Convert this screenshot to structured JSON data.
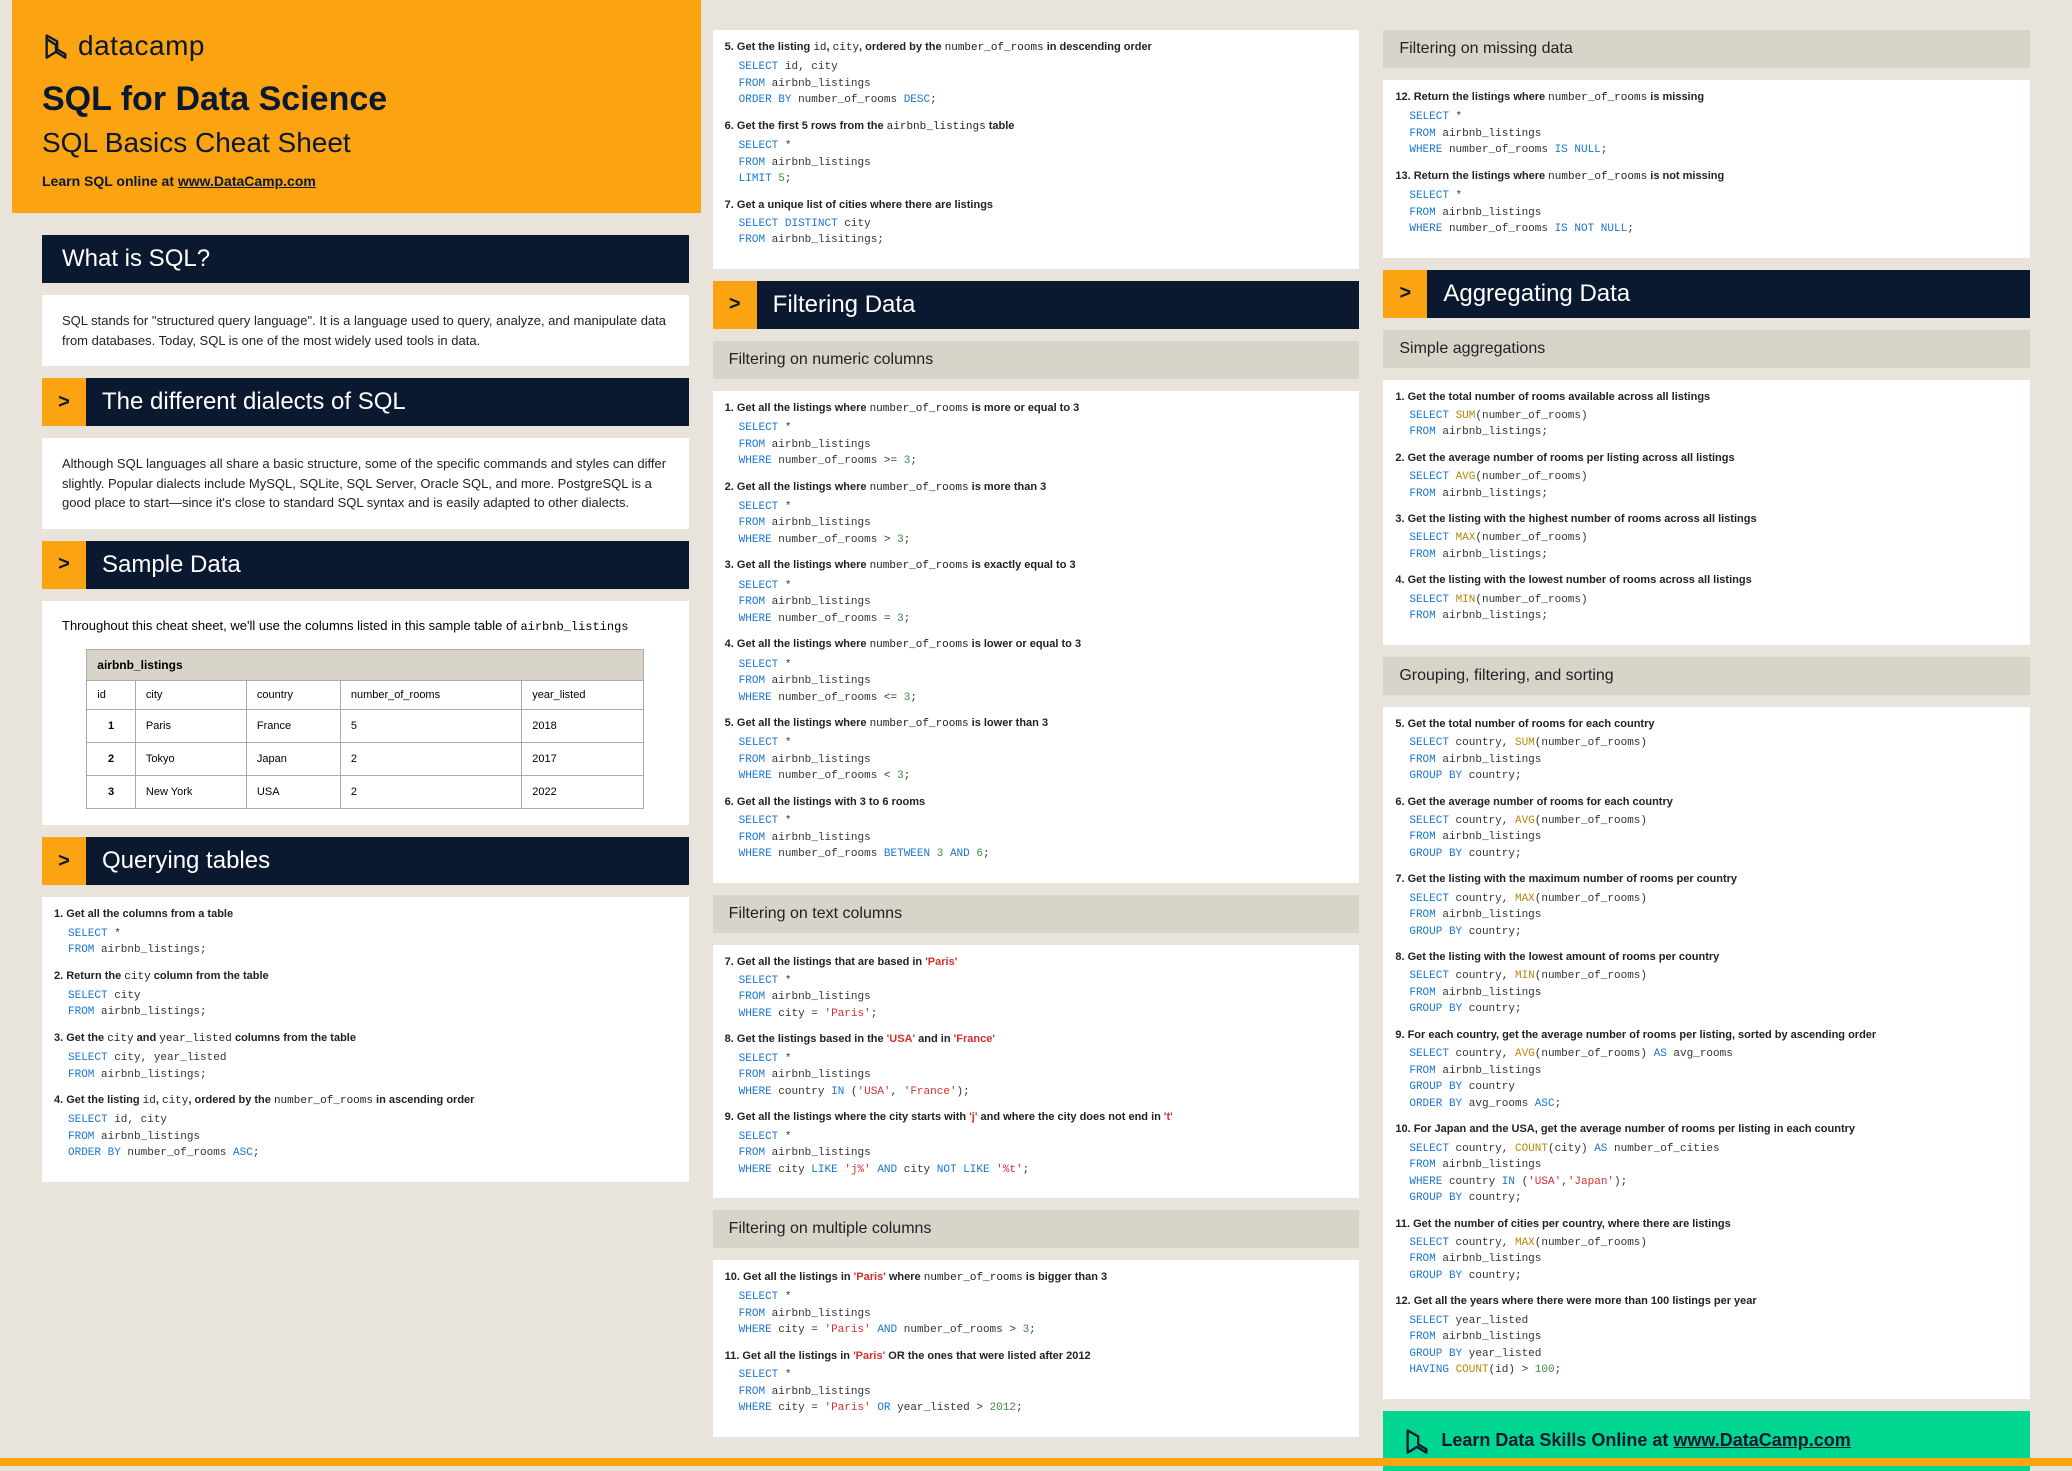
{
  "brand": {
    "name": "datacamp"
  },
  "header": {
    "title": "SQL for Data Science",
    "subtitle": "SQL Basics Cheat Sheet",
    "learn_prefix": "Learn SQL online at ",
    "learn_link": "www.DataCamp.com"
  },
  "what_is_sql": {
    "title": "What is SQL?",
    "body": "SQL stands for \"structured query language\". It is a language used to query, analyze, and manipulate data from databases. Today, SQL is one of the most widely used tools in data."
  },
  "dialects": {
    "title": "The different dialects of SQL",
    "body": "Although SQL languages all share a basic structure, some of the specific commands and styles can differ slightly. Popular dialects include MySQL, SQLite, SQL Server, Oracle SQL, and more. PostgreSQL is a good place to start—since it's close to standard SQL syntax and is easily adapted to other dialects."
  },
  "sample": {
    "title": "Sample Data",
    "intro_a": "Throughout this cheat sheet, we'll use the columns listed in this sample table of ",
    "intro_b": "airbnb_listings",
    "table_name": "airbnb_listings",
    "cols": [
      "id",
      "city",
      "country",
      "number_of_rooms",
      "year_listed"
    ],
    "rows": [
      [
        "1",
        "Paris",
        "France",
        "5",
        "2018"
      ],
      [
        "2",
        "Tokyo",
        "Japan",
        "2",
        "2017"
      ],
      [
        "3",
        "New York",
        "USA",
        "2",
        "2022"
      ]
    ]
  },
  "querying": {
    "title": "Querying tables",
    "items": [
      {
        "n": "1.",
        "label": "Get all the columns from a table",
        "code": "<span class='kw'>SELECT</span> *\n<span class='kw'>FROM</span> airbnb_listings;"
      },
      {
        "n": "2.",
        "label_html": "Return the <span class='mono'>city</span> column from the table",
        "code": "<span class='kw'>SELECT</span> city\n<span class='kw'>FROM</span> airbnb_listings;"
      },
      {
        "n": "3.",
        "label_html": "Get the <span class='mono'>city</span> and <span class='mono'>year_listed</span> columns from the table",
        "code": "<span class='kw'>SELECT</span> city, year_listed\n<span class='kw'>FROM</span> airbnb_listings;"
      },
      {
        "n": "4.",
        "label_html": "Get the listing <span class='mono'>id</span>, <span class='mono'>city</span>, ordered by the <span class='mono'>number_of_rooms</span> in ascending order",
        "code": "<span class='kw'>SELECT</span> id, city\n<span class='kw'>FROM</span> airbnb_listings\n<span class='kw'>ORDER BY</span> number_of_rooms <span class='kw'>ASC</span>;"
      }
    ]
  },
  "querying2": {
    "items": [
      {
        "n": "5.",
        "label_html": "Get the listing <span class='mono'>id</span>, <span class='mono'>city</span>, ordered by the <span class='mono'>number_of_rooms</span> in descending order",
        "code": "<span class='kw'>SELECT</span> id, city\n<span class='kw'>FROM</span> airbnb_listings\n<span class='kw'>ORDER BY</span> number_of_rooms <span class='kw'>DESC</span>;"
      },
      {
        "n": "6.",
        "label_html": "Get the first 5 rows from the <span class='mono'>airbnb_listings</span> table",
        "code": "<span class='kw'>SELECT</span> *\n<span class='kw'>FROM</span> airbnb_listings\n<span class='kw'>LIMIT</span> <span class='num'>5</span>;"
      },
      {
        "n": "7.",
        "label": "Get a unique list of cities where there are listings",
        "code": "<span class='kw'>SELECT DISTINCT</span> city\n<span class='kw'>FROM</span> airbnb_lisitings;"
      }
    ]
  },
  "filtering": {
    "title": "Filtering Data",
    "sub_numeric": "Filtering on numeric columns",
    "numeric": [
      {
        "n": "1.",
        "label_html": "Get all the listings where <span class='mono'>number_of_rooms</span> is more or equal to 3",
        "code": "<span class='kw'>SELECT</span> *\n<span class='kw'>FROM</span> airbnb_listings\n<span class='kw'>WHERE</span> number_of_rooms >= <span class='num'>3</span>;"
      },
      {
        "n": "2.",
        "label_html": "Get all the listings where <span class='mono'>number_of_rooms</span> is more than 3",
        "code": "<span class='kw'>SELECT</span> *\n<span class='kw'>FROM</span> airbnb_listings\n<span class='kw'>WHERE</span> number_of_rooms > <span class='num'>3</span>;"
      },
      {
        "n": "3.",
        "label_html": "Get all the listings where <span class='mono'>number_of_rooms</span> is exactly equal to 3",
        "code": "<span class='kw'>SELECT</span> *\n<span class='kw'>FROM</span> airbnb_listings\n<span class='kw'>WHERE</span> number_of_rooms = <span class='num'>3</span>;"
      },
      {
        "n": "4.",
        "label_html": "Get all the listings where <span class='mono'>number_of_rooms</span> is lower or equal to 3",
        "code": "<span class='kw'>SELECT</span> *\n<span class='kw'>FROM</span> airbnb_listings\n<span class='kw'>WHERE</span> number_of_rooms <= <span class='num'>3</span>;"
      },
      {
        "n": "5.",
        "label_html": "Get all the listings where <span class='mono'>number_of_rooms</span> is lower than 3",
        "code": "<span class='kw'>SELECT</span> *\n<span class='kw'>FROM</span> airbnb_listings\n<span class='kw'>WHERE</span> number_of_rooms < <span class='num'>3</span>;"
      },
      {
        "n": "6.",
        "label": "Get all the listings with 3 to 6 rooms",
        "code": "<span class='kw'>SELECT</span> *\n<span class='kw'>FROM</span> airbnb_listings\n<span class='kw'>WHERE</span> number_of_rooms <span class='kw'>BETWEEN</span> <span class='num'>3</span> <span class='kw'>AND</span> <span class='num'>6</span>;"
      }
    ],
    "sub_text": "Filtering on text columns",
    "text": [
      {
        "n": "7.",
        "label_html": "Get all the listings that are based in <span class='str'>'Paris'</span>",
        "code": "<span class='kw'>SELECT</span> *\n<span class='kw'>FROM</span> airbnb_listings\n<span class='kw'>WHERE</span> city = <span class='str'>'Paris'</span>;"
      },
      {
        "n": "8.",
        "label_html": "Get the listings based in the <span class='str'>'USA'</span> and in <span class='str'>'France'</span>",
        "code": "<span class='kw'>SELECT</span> *\n<span class='kw'>FROM</span> airbnb_listings\n<span class='kw'>WHERE</span> country <span class='kw'>IN</span> (<span class='str'>'USA'</span>, <span class='str'>'France'</span>);"
      },
      {
        "n": "9.",
        "label_html": "Get all the listings where the city starts with <span class='str'>'j'</span> and where the city does not end in <span class='str'>'t'</span>",
        "code": "<span class='kw'>SELECT</span> *\n<span class='kw'>FROM</span> airbnb_listings\n<span class='kw'>WHERE</span> city <span class='kw'>LIKE</span> <span class='str'>'j%'</span> <span class='kw'>AND</span> city <span class='kw'>NOT LIKE</span> <span class='str'>'%t'</span>;"
      }
    ],
    "sub_multi": "Filtering on multiple columns",
    "multi": [
      {
        "n": "10.",
        "label_html": "Get all the listings in <span class='str'>'Paris'</span> where <span class='mono'>number_of_rooms</span> is bigger than 3",
        "code": "<span class='kw'>SELECT</span> *\n<span class='kw'>FROM</span> airbnb_listings\n<span class='kw'>WHERE</span> city = <span class='str'>'Paris'</span> <span class='kw'>AND</span> number_of_rooms > <span class='num'>3</span>;"
      },
      {
        "n": "11.",
        "label_html": "Get all the listings in <span class='str'>'Paris'</span> OR the ones that were listed after 2012",
        "code": "<span class='kw'>SELECT</span> *\n<span class='kw'>FROM</span> airbnb_listings\n<span class='kw'>WHERE</span> city = <span class='str'>'Paris'</span> <span class='kw'>OR</span> year_listed > <span class='num'>2012</span>;"
      }
    ],
    "sub_missing": "Filtering on missing data",
    "missing": [
      {
        "n": "12.",
        "label_html": "Return the listings where <span class='mono'>number_of_rooms</span> is missing",
        "code": "<span class='kw'>SELECT</span> *\n<span class='kw'>FROM</span> airbnb_listings\n<span class='kw'>WHERE</span> number_of_rooms <span class='kw'>IS NULL</span>;"
      },
      {
        "n": "13.",
        "label_html": "Return the listings where <span class='mono'>number_of_rooms</span> is not missing",
        "code": "<span class='kw'>SELECT</span> *\n<span class='kw'>FROM</span> airbnb_listings\n<span class='kw'>WHERE</span> number_of_rooms <span class='kw'>IS NOT NULL</span>;"
      }
    ]
  },
  "agg": {
    "title": "Aggregating Data",
    "sub_simple": "Simple aggregations",
    "simple": [
      {
        "n": "1.",
        "label": "Get the total number of rooms available across all listings",
        "code": "<span class='kw'>SELECT</span> <span class='fn'>SUM</span>(number_of_rooms)\n<span class='kw'>FROM</span> airbnb_listings;"
      },
      {
        "n": "2.",
        "label": "Get the average number of rooms per listing across all listings",
        "code": "<span class='kw'>SELECT</span> <span class='fn'>AVG</span>(number_of_rooms)\n<span class='kw'>FROM</span> airbnb_listings;"
      },
      {
        "n": "3.",
        "label": "Get the listing with the highest number of rooms across all listings",
        "code": "<span class='kw'>SELECT</span> <span class='fn'>MAX</span>(number_of_rooms)\n<span class='kw'>FROM</span> airbnb_listings;"
      },
      {
        "n": "4.",
        "label": "Get the listing with the lowest number of rooms across all listings",
        "code": "<span class='kw'>SELECT</span> <span class='fn'>MIN</span>(number_of_rooms)\n<span class='kw'>FROM</span> airbnb_listings;"
      }
    ],
    "sub_group": "Grouping, filtering, and sorting",
    "group": [
      {
        "n": "5.",
        "label": "Get the total number of rooms for each country",
        "code": "<span class='kw'>SELECT</span> country, <span class='fn'>SUM</span>(number_of_rooms)\n<span class='kw'>FROM</span> airbnb_listings\n<span class='kw'>GROUP BY</span> country;"
      },
      {
        "n": "6.",
        "label": "Get the average number of rooms for each country",
        "code": "<span class='kw'>SELECT</span> country, <span class='fn'>AVG</span>(number_of_rooms)\n<span class='kw'>FROM</span> airbnb_listings\n<span class='kw'>GROUP BY</span> country;"
      },
      {
        "n": "7.",
        "label": "Get the listing with the maximum number of rooms per country",
        "code": "<span class='kw'>SELECT</span> country, <span class='fn'>MAX</span>(number_of_rooms)\n<span class='kw'>FROM</span> airbnb_listings\n<span class='kw'>GROUP BY</span> country;"
      },
      {
        "n": "8.",
        "label": "Get the listing with the lowest amount of rooms per country",
        "code": "<span class='kw'>SELECT</span> country, <span class='fn'>MIN</span>(number_of_rooms)\n<span class='kw'>FROM</span> airbnb_listings\n<span class='kw'>GROUP BY</span> country;"
      },
      {
        "n": "9.",
        "label": "For each country, get the average number of rooms per listing, sorted by ascending order",
        "code": "<span class='kw'>SELECT</span> country, <span class='fn'>AVG</span>(number_of_rooms) <span class='kw'>AS</span> avg_rooms\n<span class='kw'>FROM</span> airbnb_listings\n<span class='kw'>GROUP BY</span> country\n<span class='kw'>ORDER BY</span> avg_rooms <span class='kw'>ASC</span>;"
      },
      {
        "n": "10.",
        "label": "For Japan and the USA, get the average number of rooms per listing  in each country",
        "code": "<span class='kw'>SELECT</span> country, <span class='fn'>COUNT</span>(city) <span class='kw'>AS</span> number_of_cities\n<span class='kw'>FROM</span> airbnb_listings\n<span class='kw'>WHERE</span> country <span class='kw'>IN</span> (<span class='str'>'USA'</span>,<span class='str'>'Japan'</span>);\n<span class='kw'>GROUP BY</span> country;"
      },
      {
        "n": "11.",
        "label": "Get the number of cities per country, where there are listings",
        "code": "<span class='kw'>SELECT</span> country, <span class='fn'>MAX</span>(number_of_rooms)\n<span class='kw'>FROM</span> airbnb_listings\n<span class='kw'>GROUP BY</span> country;"
      },
      {
        "n": "12.",
        "label": "Get all the years where there were more than 100 listings per year",
        "code": "<span class='kw'>SELECT</span> year_listed\n<span class='kw'>FROM</span> airbnb_listings\n<span class='kw'>GROUP BY</span> year_listed\n<span class='kw'>HAVING</span> <span class='fn'>COUNT</span>(id) > <span class='num'>100</span>;"
      }
    ]
  },
  "footer": {
    "text": "Learn Data Skills Online at ",
    "link": "www.DataCamp.com"
  }
}
